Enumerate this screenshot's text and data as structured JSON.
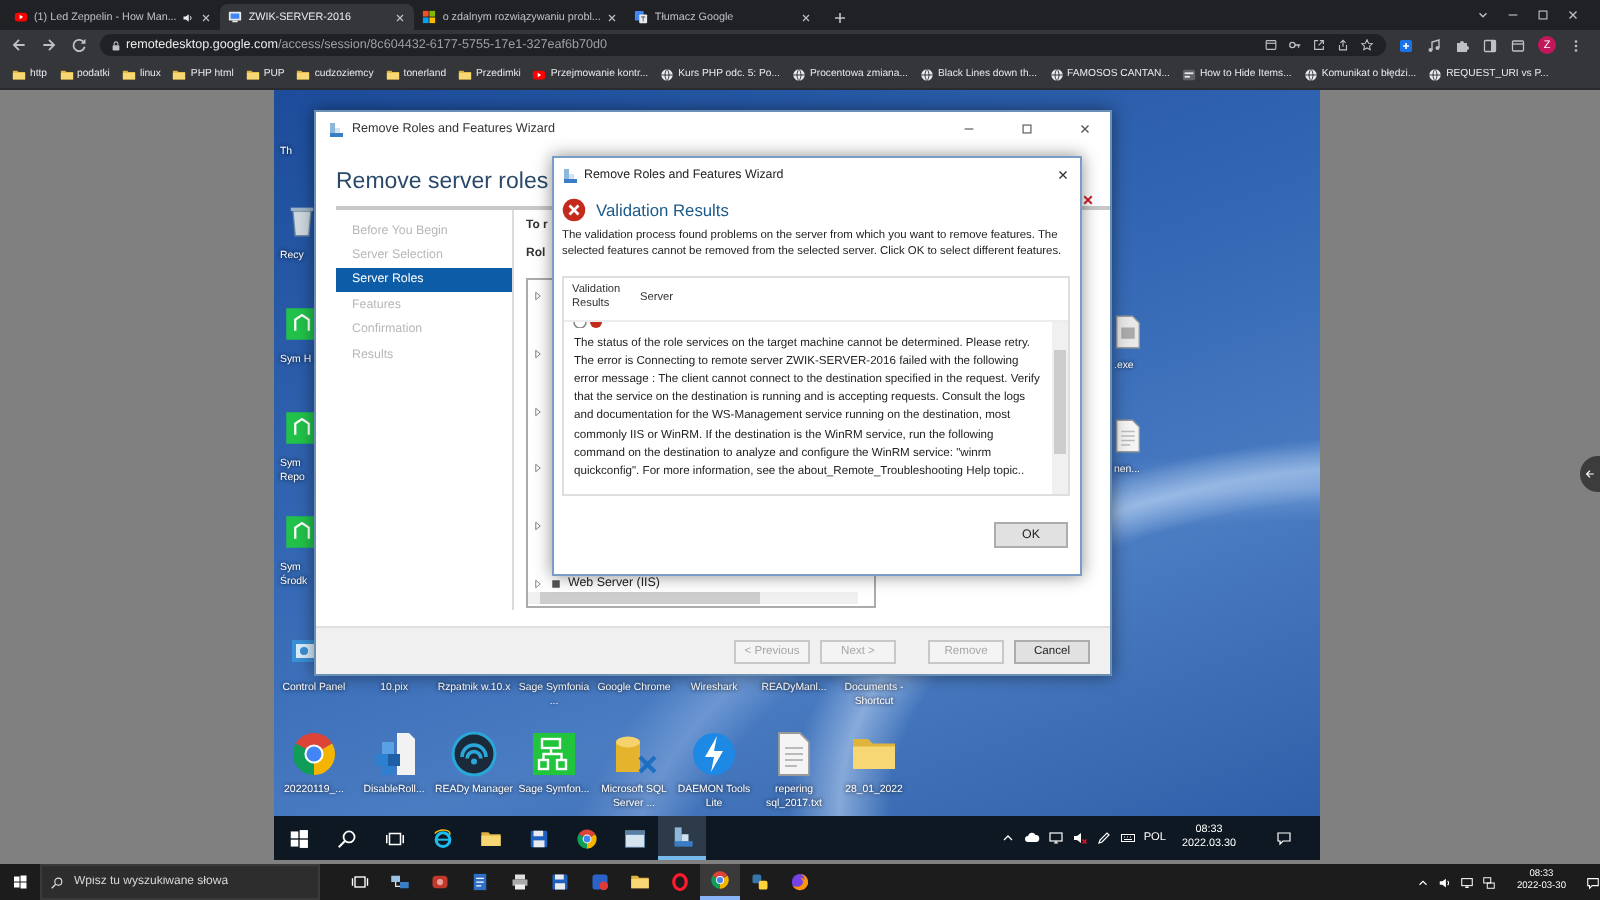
{
  "browser": {
    "tabs": [
      {
        "title": "(1) Led Zeppelin - How Man...",
        "kind": "video",
        "audio": true,
        "selected": false
      },
      {
        "title": "ZWIK-SERVER-2016",
        "kind": "remote",
        "audio": false,
        "selected": true
      },
      {
        "title": "o zdalnym rozwiązywaniu probl...",
        "kind": "windows",
        "audio": false,
        "selected": false
      },
      {
        "title": "Tłumacz Google",
        "kind": "translate",
        "audio": false,
        "selected": false
      }
    ],
    "url": {
      "host": "remotedesktop.google.com",
      "path": "/access/session/8c604432-6177-5755-17e1-327eaf6b70d0"
    },
    "profile_initial": "Z",
    "bookmarks": [
      {
        "label": "http",
        "kind": "folder"
      },
      {
        "label": "podatki",
        "kind": "folder"
      },
      {
        "label": "linux",
        "kind": "folder"
      },
      {
        "label": "PHP html",
        "kind": "folder"
      },
      {
        "label": "PUP",
        "kind": "folder"
      },
      {
        "label": "cudzoziemcy",
        "kind": "folder"
      },
      {
        "label": "tonerland",
        "kind": "folder"
      },
      {
        "label": "Przedimki",
        "kind": "folder"
      },
      {
        "label": "Przejmowanie kontr...",
        "kind": "video"
      },
      {
        "label": "Kurs PHP odc. 5: Po...",
        "kind": "globe"
      },
      {
        "label": "Procentowa zmiana...",
        "kind": "globe"
      },
      {
        "label": "Black Lines down th...",
        "kind": "globe"
      },
      {
        "label": "FAMOSOS CANTAN...",
        "kind": "globe"
      },
      {
        "label": "How to Hide Items...",
        "kind": "site"
      },
      {
        "label": "Komunikat o błędzi...",
        "kind": "globe"
      },
      {
        "label": "REQUEST_URI vs P...",
        "kind": "globe"
      }
    ]
  },
  "remote": {
    "desktop": {
      "left_column": [
        {
          "label": "Th"
        },
        {
          "label": "Recy",
          "kind": "recycle"
        },
        {
          "label": "Sym H",
          "kind": "app"
        },
        {
          "label": "Sym Repo",
          "kind": "app"
        },
        {
          "label": "Sym Środk",
          "kind": "app"
        }
      ],
      "hidden_row": [
        {
          "label": "Control Panel",
          "kind": "control"
        },
        {
          "label": "10.pix"
        },
        {
          "label": "Rzpatnik w.10.x"
        },
        {
          "label": "Sage Symfonia ..."
        },
        {
          "label": "Google Chrome"
        },
        {
          "label": "Wireshark"
        },
        {
          "label": "READyManl..."
        },
        {
          "label": "Documents - Shortcut"
        }
      ],
      "bottom_row": [
        {
          "label": "20220119_...",
          "kind": "chrome"
        },
        {
          "label": "DisableRoll...",
          "kind": "installer"
        },
        {
          "label": "READy Manager",
          "kind": "ready"
        },
        {
          "label": "Sage Symfon...",
          "kind": "sage"
        },
        {
          "label": "Microsoft SQL Server ...",
          "kind": "sql"
        },
        {
          "label": "DAEMON Tools Lite",
          "kind": "daemon"
        },
        {
          "label": "repering sql_2017.txt",
          "kind": "file"
        },
        {
          "label": "28_01_2022",
          "kind": "folder"
        }
      ],
      "right_column": [
        {
          "label": ".exe",
          "kind": "exe"
        },
        {
          "label": "nen...",
          "kind": "file"
        }
      ]
    },
    "wizard": {
      "title": "Remove Roles and Features Wizard",
      "heading": "Remove server roles",
      "steps": [
        {
          "label": "Before You Begin",
          "selected": false
        },
        {
          "label": "Server Selection",
          "selected": false
        },
        {
          "label": "Server Roles",
          "selected": true
        },
        {
          "label": "Features",
          "selected": false
        },
        {
          "label": "Confirmation",
          "selected": false
        },
        {
          "label": "Results",
          "selected": false
        }
      ],
      "intro": "To r",
      "list_label": "Rol",
      "roles": [
        {
          "expanded": false
        },
        {
          "expanded": false
        },
        {
          "expanded": false
        },
        {
          "expanded": false
        },
        {
          "expanded": false
        },
        {
          "expanded": false,
          "label": "Web Server (IIS)"
        }
      ],
      "buttons": [
        {
          "label": "< Previous",
          "disabled": true
        },
        {
          "label": "Next >",
          "disabled": true
        },
        {
          "label": "Remove",
          "disabled": true
        },
        {
          "label": "Cancel",
          "disabled": false
        }
      ]
    },
    "dialog": {
      "title": "Remove Roles and Features Wizard",
      "heading": "Validation Results",
      "message": "The validation process found problems on the server from which you want to remove features. The selected features cannot be removed from the selected server.  Click OK to select different features.",
      "columns": [
        "Validation Results",
        "Server"
      ],
      "detail": "The status of the role services on the target machine cannot be determined. Please retry. The error is Connecting to remote server ZWIK-SERVER-2016 failed with the following error message : The client cannot connect to the destination specified in the request. Verify that the service on the destination is running and is accepting requests. Consult the logs and documentation for the WS-Management service running on the destination, most commonly IIS or WinRM. If the destination is the WinRM service, run the following command on the destination to analyze and configure the WinRM service: \"winrm quickconfig\". For more information, see the about_Remote_Troubleshooting Help topic..",
      "button": "OK"
    },
    "taskbar": {
      "apps": [
        {
          "kind": "start",
          "active": false
        },
        {
          "kind": "search",
          "active": false
        },
        {
          "kind": "taskview",
          "active": false
        },
        {
          "kind": "ie",
          "active": false
        },
        {
          "kind": "folder",
          "active": false
        },
        {
          "kind": "floppy",
          "active": false
        },
        {
          "kind": "chrome",
          "active": false
        },
        {
          "kind": "window",
          "active": false
        },
        {
          "kind": "wizard",
          "active": true
        }
      ],
      "tray": [
        {
          "kind": "caret"
        },
        {
          "kind": "cloud"
        },
        {
          "kind": "monitor"
        },
        {
          "kind": "speakermute"
        },
        {
          "kind": "pen"
        },
        {
          "kind": "keyboard"
        }
      ],
      "language": "POL",
      "time": "08:33",
      "date": "2022.03.30"
    }
  },
  "taskbar": {
    "search": {
      "placeholder": "Wpisz tu wyszukiwane słowa"
    },
    "apps": [
      {
        "kind": "taskview",
        "active": false
      },
      {
        "kind": "share",
        "active": false
      },
      {
        "kind": "redapp",
        "active": false
      },
      {
        "kind": "bluedoc",
        "active": false
      },
      {
        "kind": "printer",
        "active": false
      },
      {
        "kind": "floppy",
        "active": false
      },
      {
        "kind": "mixed",
        "active": false
      },
      {
        "kind": "folder",
        "active": false
      },
      {
        "kind": "opera",
        "active": false
      },
      {
        "kind": "chrome",
        "active": true
      },
      {
        "kind": "python",
        "active": false
      },
      {
        "kind": "firefox",
        "active": false
      }
    ],
    "tray": [
      {
        "kind": "caret"
      },
      {
        "kind": "speaker"
      },
      {
        "kind": "monitor"
      },
      {
        "kind": "network"
      }
    ],
    "time": "08:33",
    "date": "2022-03-30"
  }
}
